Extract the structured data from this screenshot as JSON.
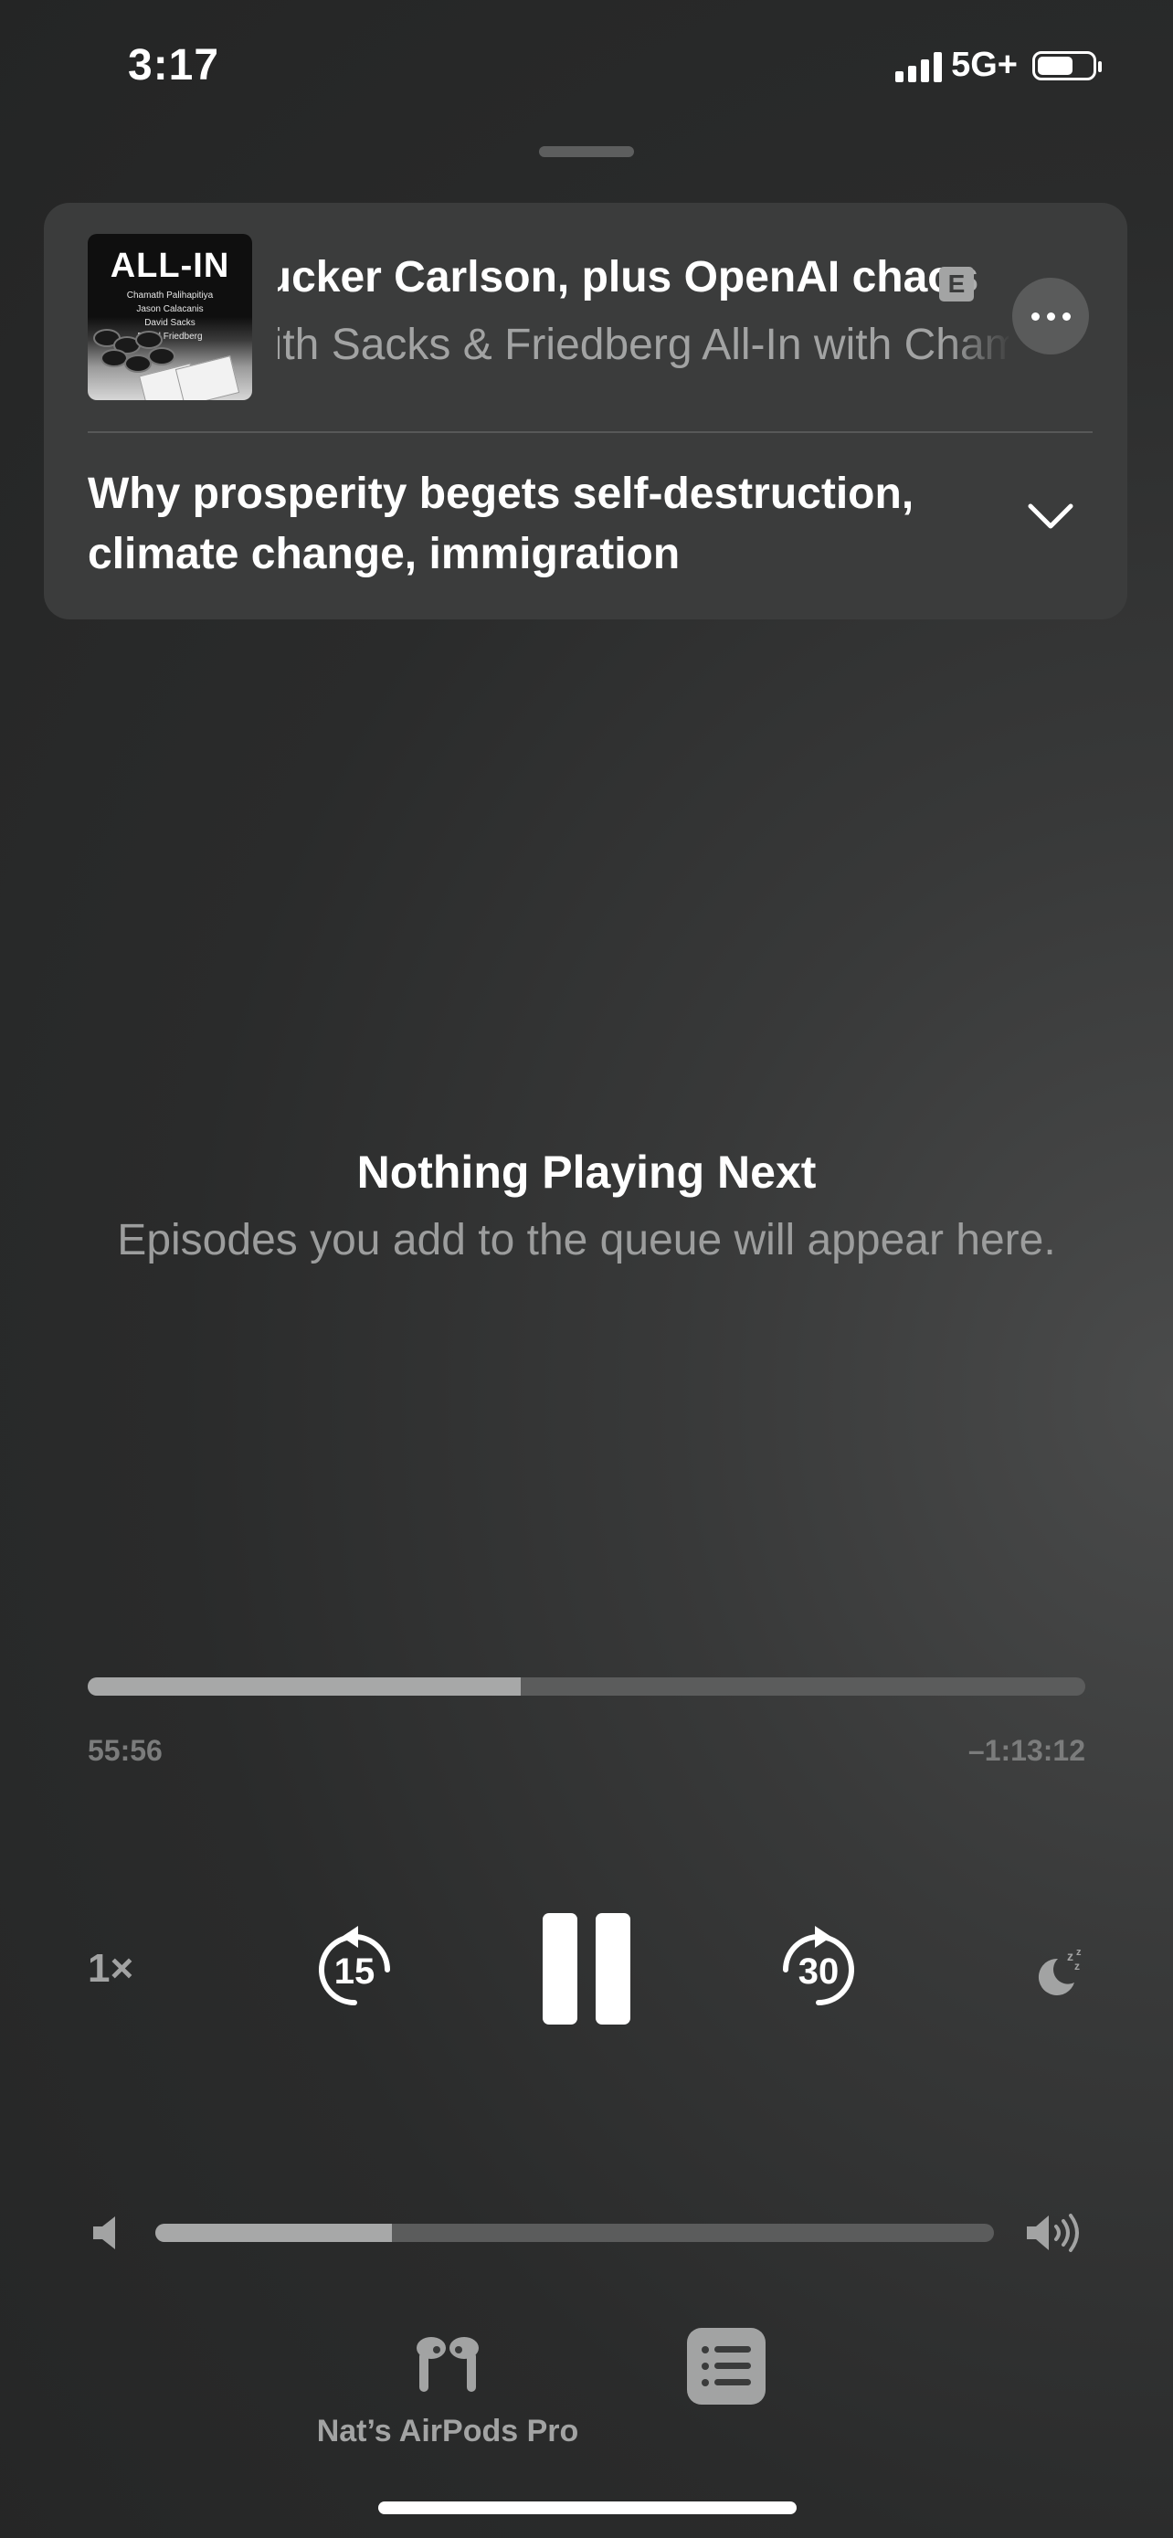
{
  "status_bar": {
    "time": "3:17",
    "network": "5G+",
    "icons": [
      "cellular-signal-icon",
      "battery-icon"
    ]
  },
  "episode": {
    "artwork": {
      "title": "ALL-IN",
      "names": [
        "Chamath Palihapitiya",
        "Jason Calacanis",
        "David Sacks",
        "David Friedberg"
      ]
    },
    "title": "Tucker Carlson, plus OpenAI chaos",
    "explicit_badge": "E",
    "subtitle": "with Sacks & Friedberg      All-In with Chamath",
    "chapter": "Why prosperity begets self-destruction, climate change, immigration",
    "icons": [
      "more-icon",
      "chevron-down-icon"
    ]
  },
  "queue": {
    "empty_title": "Nothing Playing Next",
    "empty_text": "Episodes you add to the queue will appear here."
  },
  "playback": {
    "progress_fraction": 0.434,
    "elapsed": "55:56",
    "remaining": "–1:13:12",
    "speed": "1×",
    "skip_back": "15",
    "skip_forward": "30",
    "icons": [
      "skip-back-15-icon",
      "pause-icon",
      "skip-forward-30-icon",
      "sleep-timer-icon"
    ]
  },
  "volume": {
    "level_fraction": 0.282,
    "icons": [
      "volume-low-icon",
      "volume-high-icon"
    ]
  },
  "bottom": {
    "airplay_label": "Nat’s AirPods Pro",
    "icons": [
      "airpods-icon",
      "queue-list-icon"
    ]
  },
  "colors": {
    "background": "#2a2b2b",
    "card": "#3b3c3c",
    "secondary_text": "#a2a3a3",
    "track": "#5b5c5c",
    "track_fill": "#a7a8a8"
  }
}
